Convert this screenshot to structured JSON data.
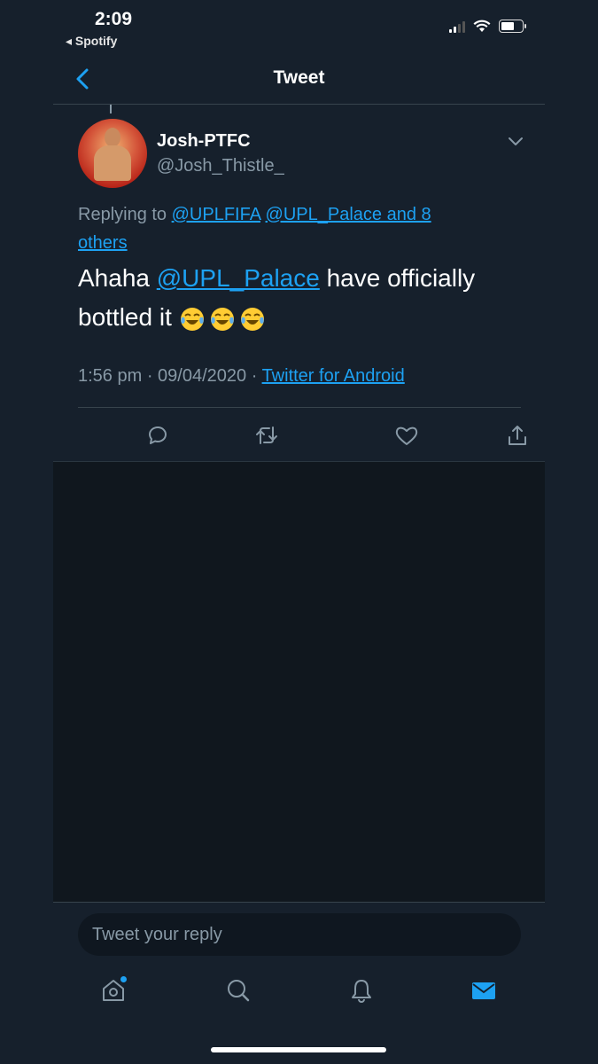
{
  "status_bar": {
    "time": "2:09",
    "back_app": "◂ Spotify"
  },
  "header": {
    "title": "Tweet"
  },
  "tweet": {
    "display_name": "Josh-PTFC",
    "handle": "@Josh_Thistle_",
    "replying_prefix": "Replying to ",
    "replying_link_1": "@UPLFIFA",
    "replying_link_2": "@UPL_Palace and 8",
    "replying_link_3": "others",
    "text_start": "Ahaha ",
    "text_mention": "@UPL_Palace",
    "text_end": " have officially bottled it ",
    "emoji": [
      "face-with-tears-of-joy",
      "face-with-tears-of-joy",
      "face-with-tears-of-joy"
    ],
    "time": "1:56 pm · 09/04/2020 · ",
    "source": "Twitter for Android"
  },
  "reply_box": {
    "placeholder": "Tweet your reply"
  },
  "icons": {
    "back": "chevron-left-icon",
    "more": "chevron-down-icon",
    "reply": "comment-icon",
    "retweet": "retweet-icon",
    "like": "heart-icon",
    "share": "share-icon",
    "home": "home-icon",
    "search": "search-icon",
    "notifications": "bell-icon",
    "messages": "envelope-icon"
  },
  "colors": {
    "background": "#16202c",
    "accent": "#1da1f2",
    "secondary_text": "#8899a6",
    "divider": "#38444d"
  }
}
